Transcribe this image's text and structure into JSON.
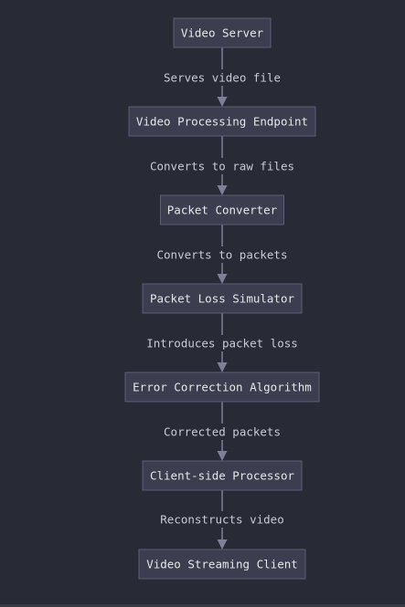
{
  "diagram": {
    "nodes": [
      {
        "id": "video-server",
        "label": "Video Server"
      },
      {
        "id": "video-processing-endpoint",
        "label": "Video Processing Endpoint"
      },
      {
        "id": "packet-converter",
        "label": "Packet Converter"
      },
      {
        "id": "packet-loss-simulator",
        "label": "Packet Loss Simulator"
      },
      {
        "id": "error-correction-algorithm",
        "label": "Error Correction Algorithm"
      },
      {
        "id": "client-side-processor",
        "label": "Client-side Processor"
      },
      {
        "id": "video-streaming-client",
        "label": "Video Streaming Client"
      }
    ],
    "edges": [
      {
        "from": "video-server",
        "to": "video-processing-endpoint",
        "label": "Serves video file"
      },
      {
        "from": "video-processing-endpoint",
        "to": "packet-converter",
        "label": "Converts to raw files"
      },
      {
        "from": "packet-converter",
        "to": "packet-loss-simulator",
        "label": "Converts to packets"
      },
      {
        "from": "packet-loss-simulator",
        "to": "error-correction-algorithm",
        "label": "Introduces packet loss"
      },
      {
        "from": "error-correction-algorithm",
        "to": "client-side-processor",
        "label": "Corrected packets"
      },
      {
        "from": "client-side-processor",
        "to": "video-streaming-client",
        "label": "Reconstructs video"
      }
    ]
  }
}
